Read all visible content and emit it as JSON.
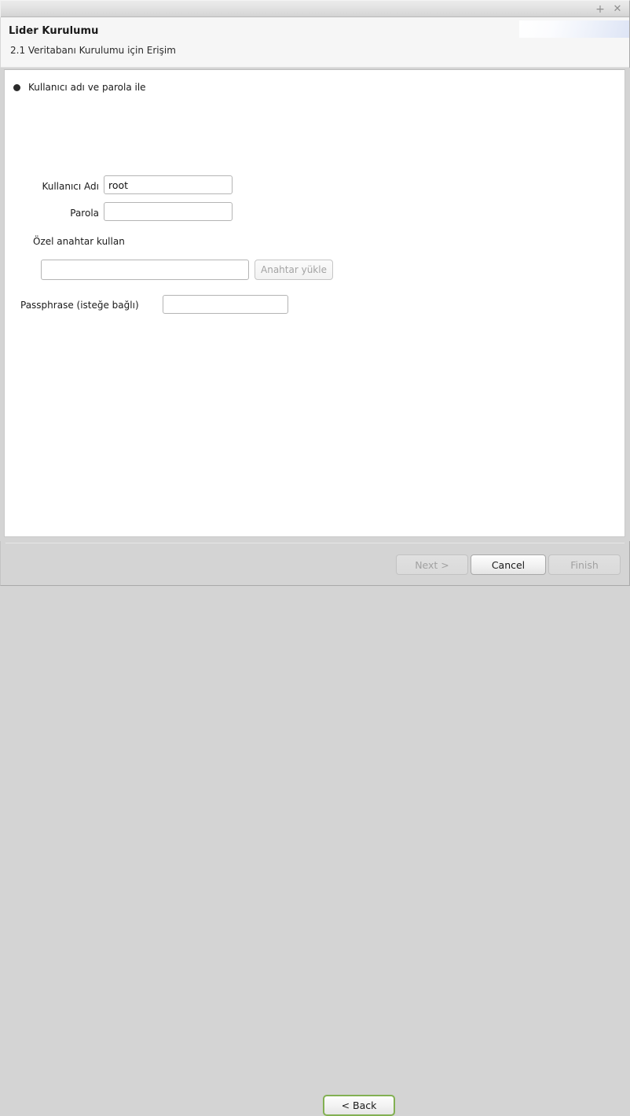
{
  "window": {
    "titlebar": {
      "maximize_glyph": "+",
      "close_glyph": "✕"
    }
  },
  "header": {
    "title": "Lider Kurulumu",
    "subtitle": "2.1 Veritabanı Kurulumu için Erişim"
  },
  "form": {
    "auth_option_label": "Kullanıcı adı ve parola ile",
    "username": {
      "label": "Kullanıcı Adı",
      "value": "root",
      "placeholder": ""
    },
    "password": {
      "label": "Parola",
      "value": "",
      "placeholder": ""
    },
    "private_key_section_label": "Özel anahtar kullan",
    "key_path": {
      "value": "",
      "placeholder": ""
    },
    "load_key_button": {
      "label": "Anahtar yükle",
      "enabled": false
    },
    "passphrase": {
      "label": "Passphrase (isteğe bağlı)",
      "value": "",
      "placeholder": ""
    }
  },
  "footer": {
    "back_button": {
      "label": "< Back",
      "enabled": true,
      "focused": true
    },
    "next_button": {
      "label": "Next >",
      "enabled": false,
      "focused": false
    },
    "cancel_button": {
      "label": "Cancel",
      "enabled": true,
      "focused": false
    },
    "finish_button": {
      "label": "Finish",
      "enabled": false,
      "focused": false
    }
  },
  "colors": {
    "focus_green": "#82b052",
    "window_chrome": "#d4d4d4",
    "panel_background": "#ffffff",
    "header_background": "#f6f6f6",
    "disabled_text": "#a1a1a1"
  }
}
